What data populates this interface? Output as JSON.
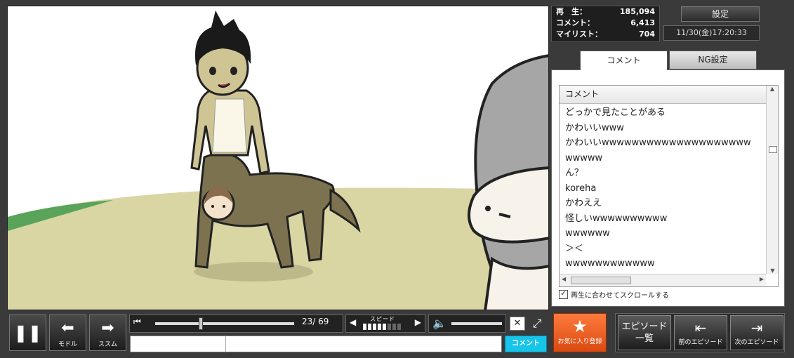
{
  "stats": {
    "views_label": "再　生：",
    "views": "185,094",
    "comments_label": "コメント：",
    "comments": "6,413",
    "mylist_label": "マイリスト：",
    "mylist": "704"
  },
  "header": {
    "settings_label": "設定",
    "datetime": "11/30(金)17:20:33"
  },
  "tabs": {
    "comment": "コメント",
    "ng": "NG設定"
  },
  "comment_list": {
    "header": "コメント",
    "items": [
      "どっかで見たことがある",
      "かわいいwww",
      "かわいいwwwwwwwwwwwwwwwwwwww",
      "wwwww",
      "ん？",
      "koreha",
      "かわええ",
      "怪しいwwwwwwwwww",
      "wwwwww",
      "＞＜",
      "wwwwwwwwwwww"
    ],
    "autoscroll_label": "再生に合わせてスクロールする",
    "autoscroll_checked": true
  },
  "controls": {
    "back_label": "モドル",
    "forward_label": "ススム",
    "time": "23/  69",
    "progress": 0.33,
    "speed_label": "スピード",
    "speed_level": 5,
    "volume_level": 1.0,
    "comment_submit_label": "コメント",
    "command_value": "",
    "comment_value": ""
  },
  "footer": {
    "favorite_label": "お気に入り登録",
    "episode_list_label": "エピソード\n一覧",
    "prev_episode_label": "前のエピソード",
    "next_episode_label": "次のエピソード"
  },
  "colors": {
    "comment_submit_bg": "#17c4ea",
    "favorite_bg": "#e8561c"
  }
}
